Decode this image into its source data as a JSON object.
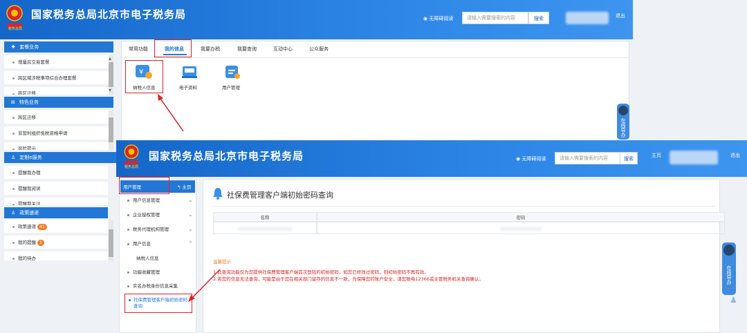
{
  "header1": {
    "logo_text": "税务总局",
    "title": "国家税务总局北京市电子税务局",
    "accessibility": "无障碍阅读",
    "search_placeholder": "请输入需要搜索的内容",
    "search_button": "搜索",
    "logout": "退出"
  },
  "sidebar1": {
    "sections": [
      {
        "icon": "package-icon",
        "label": "套餐业务",
        "items": [
          "增量房交易套餐",
          "跨区域涉税事项综合办理套餐",
          "跨区迁移"
        ]
      },
      {
        "icon": "grid-icon",
        "label": "特色业务",
        "items": [
          "跨区迁移",
          "非营利组织免税资格申请",
          "风险提示"
        ]
      },
      {
        "icon": "user-icon",
        "label": "定制e服务",
        "items": [
          "提醒我办理",
          "提醒我阅读",
          "提醒我关注"
        ]
      },
      {
        "icon": "user-icon",
        "label": "政策速递",
        "items": [
          "政策速递",
          "我的提醒",
          "我的待办"
        ]
      }
    ],
    "badges": {
      "policy": "41",
      "reminder": "1"
    }
  },
  "main1": {
    "tabs": [
      "常用功能",
      "我的信息",
      "我要办税",
      "我要查询",
      "互动中心",
      "公众服务"
    ],
    "active_tab": "我的信息",
    "functions": [
      {
        "icon": "taxpayer-info-icon",
        "label": "纳税人信息"
      },
      {
        "icon": "electronic-data-icon",
        "label": "电子资料"
      },
      {
        "icon": "user-management-icon",
        "label": "用户管理"
      }
    ]
  },
  "float_button": "在线导办",
  "header2": {
    "logo_text": "税务总局",
    "title": "国家税务总局北京市电子税务局",
    "accessibility": "无障碍阅读",
    "search_placeholder": "请输入需要搜索的内容",
    "search_button": "搜索",
    "home": "主页",
    "logout": "退出"
  },
  "sidebar2": {
    "header": "用户管理",
    "home_link": "主页",
    "items": [
      "用户信息管理",
      "企业授权管理",
      "税务代理机构管理",
      "用户信息",
      "纳税人信息",
      "功能收藏管理",
      "实名办税身份信息采集",
      "社保费管理客户端初始密码查询"
    ]
  },
  "content2": {
    "title": "社保费管理客户端初始密码查询",
    "columns": [
      "名称",
      "密码"
    ],
    "notice_title": "温馨提示",
    "notices": [
      "1.此查询功能仅为您提供社保费管理客户端首次登陆的初始密码，如您已修改过密码，则初始密码不再有效。",
      "2.若您的信息无法查询，可能是由于您在相关部门留存的信息不一致，为保障您的账户安全，请您致电12366或主管税务机关查询确认。"
    ]
  },
  "colors": {
    "primary": "#2377d4",
    "highlight": "#e02020",
    "badge": "#f27d2b"
  }
}
